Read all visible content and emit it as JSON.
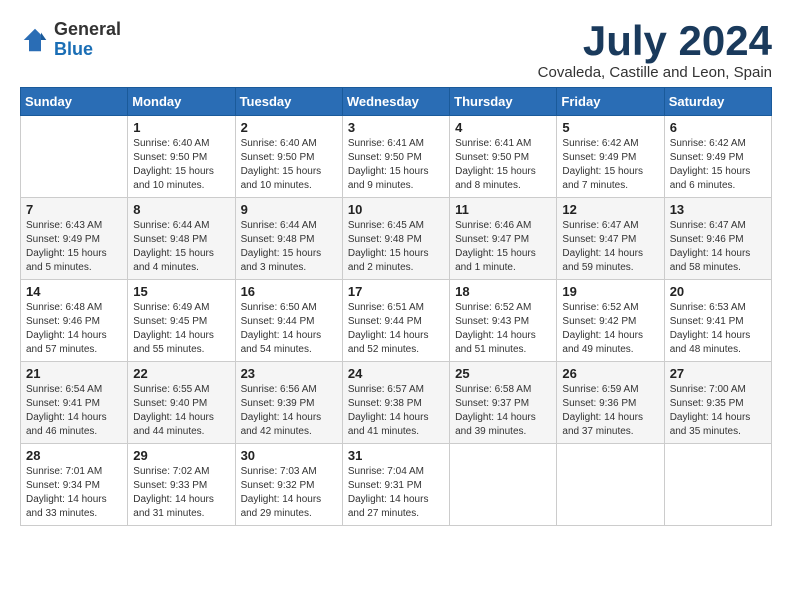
{
  "logo": {
    "general": "General",
    "blue": "Blue"
  },
  "title": "July 2024",
  "location": "Covaleda, Castille and Leon, Spain",
  "weekdays": [
    "Sunday",
    "Monday",
    "Tuesday",
    "Wednesday",
    "Thursday",
    "Friday",
    "Saturday"
  ],
  "weeks": [
    [
      {
        "day": "",
        "sunrise": "",
        "sunset": "",
        "daylight": ""
      },
      {
        "day": "1",
        "sunrise": "Sunrise: 6:40 AM",
        "sunset": "Sunset: 9:50 PM",
        "daylight": "Daylight: 15 hours and 10 minutes."
      },
      {
        "day": "2",
        "sunrise": "Sunrise: 6:40 AM",
        "sunset": "Sunset: 9:50 PM",
        "daylight": "Daylight: 15 hours and 10 minutes."
      },
      {
        "day": "3",
        "sunrise": "Sunrise: 6:41 AM",
        "sunset": "Sunset: 9:50 PM",
        "daylight": "Daylight: 15 hours and 9 minutes."
      },
      {
        "day": "4",
        "sunrise": "Sunrise: 6:41 AM",
        "sunset": "Sunset: 9:50 PM",
        "daylight": "Daylight: 15 hours and 8 minutes."
      },
      {
        "day": "5",
        "sunrise": "Sunrise: 6:42 AM",
        "sunset": "Sunset: 9:49 PM",
        "daylight": "Daylight: 15 hours and 7 minutes."
      },
      {
        "day": "6",
        "sunrise": "Sunrise: 6:42 AM",
        "sunset": "Sunset: 9:49 PM",
        "daylight": "Daylight: 15 hours and 6 minutes."
      }
    ],
    [
      {
        "day": "7",
        "sunrise": "Sunrise: 6:43 AM",
        "sunset": "Sunset: 9:49 PM",
        "daylight": "Daylight: 15 hours and 5 minutes."
      },
      {
        "day": "8",
        "sunrise": "Sunrise: 6:44 AM",
        "sunset": "Sunset: 9:48 PM",
        "daylight": "Daylight: 15 hours and 4 minutes."
      },
      {
        "day": "9",
        "sunrise": "Sunrise: 6:44 AM",
        "sunset": "Sunset: 9:48 PM",
        "daylight": "Daylight: 15 hours and 3 minutes."
      },
      {
        "day": "10",
        "sunrise": "Sunrise: 6:45 AM",
        "sunset": "Sunset: 9:48 PM",
        "daylight": "Daylight: 15 hours and 2 minutes."
      },
      {
        "day": "11",
        "sunrise": "Sunrise: 6:46 AM",
        "sunset": "Sunset: 9:47 PM",
        "daylight": "Daylight: 15 hours and 1 minute."
      },
      {
        "day": "12",
        "sunrise": "Sunrise: 6:47 AM",
        "sunset": "Sunset: 9:47 PM",
        "daylight": "Daylight: 14 hours and 59 minutes."
      },
      {
        "day": "13",
        "sunrise": "Sunrise: 6:47 AM",
        "sunset": "Sunset: 9:46 PM",
        "daylight": "Daylight: 14 hours and 58 minutes."
      }
    ],
    [
      {
        "day": "14",
        "sunrise": "Sunrise: 6:48 AM",
        "sunset": "Sunset: 9:46 PM",
        "daylight": "Daylight: 14 hours and 57 minutes."
      },
      {
        "day": "15",
        "sunrise": "Sunrise: 6:49 AM",
        "sunset": "Sunset: 9:45 PM",
        "daylight": "Daylight: 14 hours and 55 minutes."
      },
      {
        "day": "16",
        "sunrise": "Sunrise: 6:50 AM",
        "sunset": "Sunset: 9:44 PM",
        "daylight": "Daylight: 14 hours and 54 minutes."
      },
      {
        "day": "17",
        "sunrise": "Sunrise: 6:51 AM",
        "sunset": "Sunset: 9:44 PM",
        "daylight": "Daylight: 14 hours and 52 minutes."
      },
      {
        "day": "18",
        "sunrise": "Sunrise: 6:52 AM",
        "sunset": "Sunset: 9:43 PM",
        "daylight": "Daylight: 14 hours and 51 minutes."
      },
      {
        "day": "19",
        "sunrise": "Sunrise: 6:52 AM",
        "sunset": "Sunset: 9:42 PM",
        "daylight": "Daylight: 14 hours and 49 minutes."
      },
      {
        "day": "20",
        "sunrise": "Sunrise: 6:53 AM",
        "sunset": "Sunset: 9:41 PM",
        "daylight": "Daylight: 14 hours and 48 minutes."
      }
    ],
    [
      {
        "day": "21",
        "sunrise": "Sunrise: 6:54 AM",
        "sunset": "Sunset: 9:41 PM",
        "daylight": "Daylight: 14 hours and 46 minutes."
      },
      {
        "day": "22",
        "sunrise": "Sunrise: 6:55 AM",
        "sunset": "Sunset: 9:40 PM",
        "daylight": "Daylight: 14 hours and 44 minutes."
      },
      {
        "day": "23",
        "sunrise": "Sunrise: 6:56 AM",
        "sunset": "Sunset: 9:39 PM",
        "daylight": "Daylight: 14 hours and 42 minutes."
      },
      {
        "day": "24",
        "sunrise": "Sunrise: 6:57 AM",
        "sunset": "Sunset: 9:38 PM",
        "daylight": "Daylight: 14 hours and 41 minutes."
      },
      {
        "day": "25",
        "sunrise": "Sunrise: 6:58 AM",
        "sunset": "Sunset: 9:37 PM",
        "daylight": "Daylight: 14 hours and 39 minutes."
      },
      {
        "day": "26",
        "sunrise": "Sunrise: 6:59 AM",
        "sunset": "Sunset: 9:36 PM",
        "daylight": "Daylight: 14 hours and 37 minutes."
      },
      {
        "day": "27",
        "sunrise": "Sunrise: 7:00 AM",
        "sunset": "Sunset: 9:35 PM",
        "daylight": "Daylight: 14 hours and 35 minutes."
      }
    ],
    [
      {
        "day": "28",
        "sunrise": "Sunrise: 7:01 AM",
        "sunset": "Sunset: 9:34 PM",
        "daylight": "Daylight: 14 hours and 33 minutes."
      },
      {
        "day": "29",
        "sunrise": "Sunrise: 7:02 AM",
        "sunset": "Sunset: 9:33 PM",
        "daylight": "Daylight: 14 hours and 31 minutes."
      },
      {
        "day": "30",
        "sunrise": "Sunrise: 7:03 AM",
        "sunset": "Sunset: 9:32 PM",
        "daylight": "Daylight: 14 hours and 29 minutes."
      },
      {
        "day": "31",
        "sunrise": "Sunrise: 7:04 AM",
        "sunset": "Sunset: 9:31 PM",
        "daylight": "Daylight: 14 hours and 27 minutes."
      },
      {
        "day": "",
        "sunrise": "",
        "sunset": "",
        "daylight": ""
      },
      {
        "day": "",
        "sunrise": "",
        "sunset": "",
        "daylight": ""
      },
      {
        "day": "",
        "sunrise": "",
        "sunset": "",
        "daylight": ""
      }
    ]
  ]
}
